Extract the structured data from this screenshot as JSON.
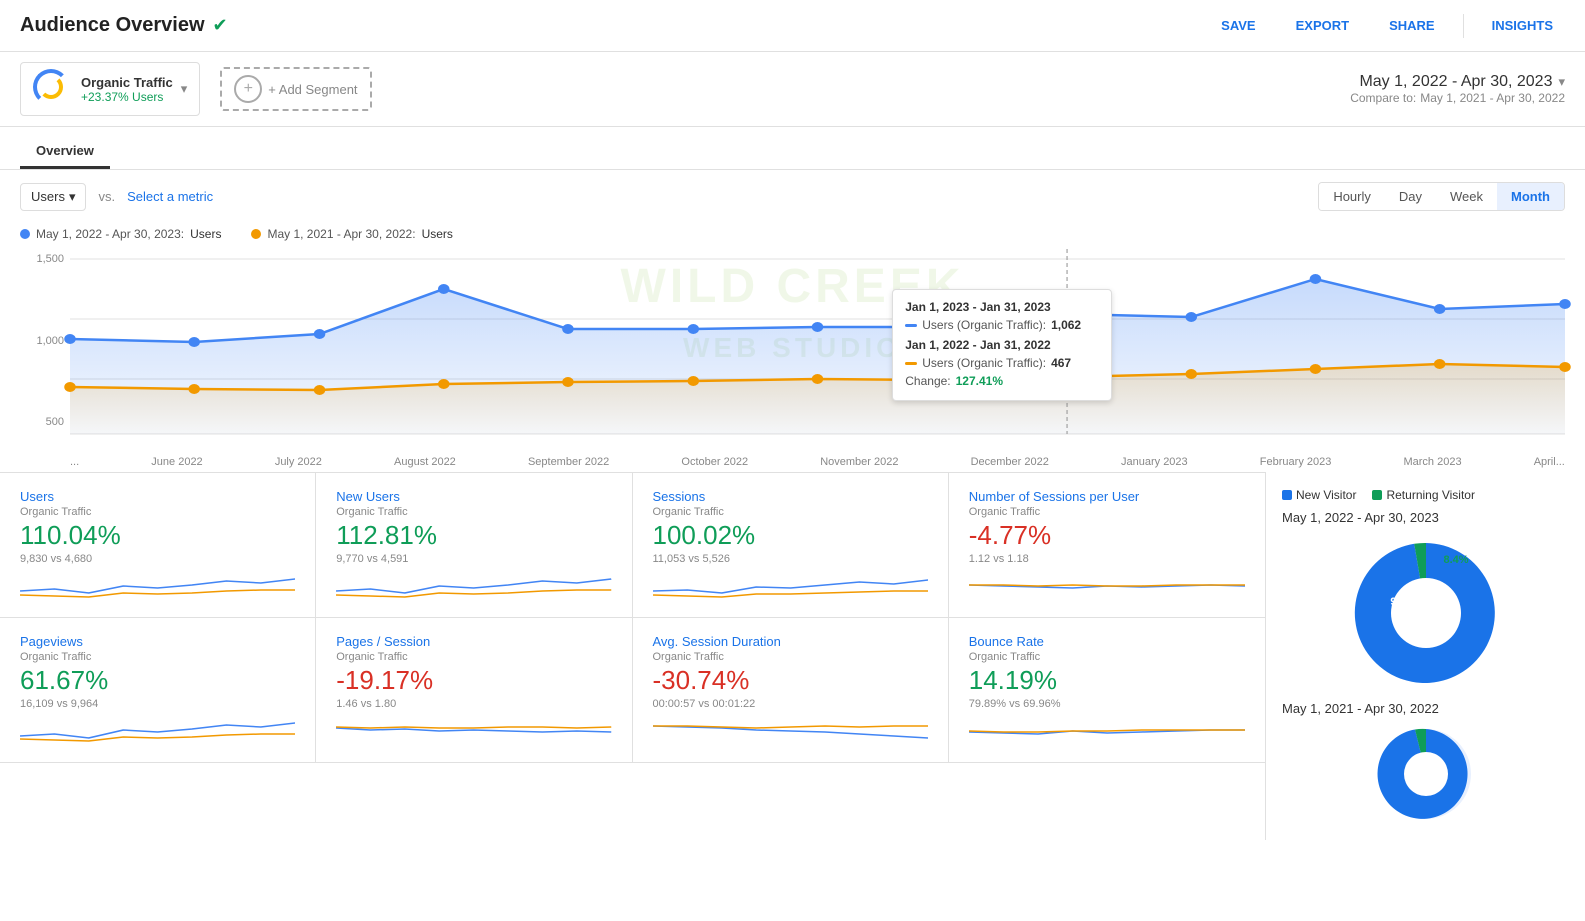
{
  "header": {
    "title": "Audience Overview",
    "save_label": "SAVE",
    "export_label": "EXPORT",
    "share_label": "SHARE",
    "insights_label": "INSIGHTS"
  },
  "segment": {
    "name": "Organic Traffic",
    "change": "+23.37% Users",
    "add_label": "+ Add Segment"
  },
  "date_range": {
    "current": "May 1, 2022 - Apr 30, 2023",
    "compare_prefix": "Compare to:",
    "compare": "May 1, 2021 - Apr 30, 2022"
  },
  "tabs": [
    "Overview"
  ],
  "chart_controls": {
    "metric": "Users",
    "vs_label": "vs.",
    "select_metric": "Select a metric",
    "time_buttons": [
      "Hourly",
      "Day",
      "Week",
      "Month"
    ],
    "active_time": "Month"
  },
  "legend": {
    "date1": "May 1, 2022 - Apr 30, 2023:",
    "label1": "Users",
    "date2": "May 1, 2021 - Apr 30, 2022:",
    "label2": "Users"
  },
  "y_axis": [
    "1,500",
    "1,000",
    "500"
  ],
  "x_axis": [
    "...",
    "June 2022",
    "July 2022",
    "August 2022",
    "September 2022",
    "October 2022",
    "November 2022",
    "December 2022",
    "January 2023",
    "February 2023",
    "March 2023",
    "April..."
  ],
  "tooltip": {
    "title1": "Jan 1, 2023 - Jan 31, 2023",
    "metric1_label": "Users (Organic Traffic):",
    "metric1_value": "1,062",
    "title2": "Jan 1, 2022 - Jan 31, 2022",
    "metric2_label": "Users (Organic Traffic):",
    "metric2_value": "467",
    "change_label": "Change:",
    "change_value": "127.41%"
  },
  "metrics": [
    {
      "label": "Users",
      "segment": "Organic Traffic",
      "value": "110.04%",
      "positive": true,
      "sub": "9,830 vs 4,680"
    },
    {
      "label": "New Users",
      "segment": "Organic Traffic",
      "value": "112.81%",
      "positive": true,
      "sub": "9,770 vs 4,591"
    },
    {
      "label": "Sessions",
      "segment": "Organic Traffic",
      "value": "100.02%",
      "positive": true,
      "sub": "11,053 vs 5,526"
    },
    {
      "label": "Number of Sessions per User",
      "segment": "Organic Traffic",
      "value": "-4.77%",
      "positive": false,
      "sub": "1.12 vs 1.18"
    }
  ],
  "metrics_row2": [
    {
      "label": "Pageviews",
      "segment": "Organic Traffic",
      "value": "61.67%",
      "positive": true,
      "sub": "16,109 vs 9,964"
    },
    {
      "label": "Pages / Session",
      "segment": "Organic Traffic",
      "value": "-19.17%",
      "positive": false,
      "sub": "1.46 vs 1.80"
    },
    {
      "label": "Avg. Session Duration",
      "segment": "Organic Traffic",
      "value": "-30.74%",
      "positive": false,
      "sub": "00:00:57 vs 00:01:22"
    },
    {
      "label": "Bounce Rate",
      "segment": "Organic Traffic",
      "value": "14.19%",
      "positive": true,
      "sub": "79.89% vs 69.96%"
    }
  ],
  "pie": {
    "legend_new": "New Visitor",
    "legend_returning": "Returning Visitor",
    "title1": "May 1, 2022 - Apr 30, 2023",
    "new_pct1": "91.6%",
    "returning_pct1": "8.4%",
    "title2": "May 1, 2021 - Apr 30, 2022"
  }
}
